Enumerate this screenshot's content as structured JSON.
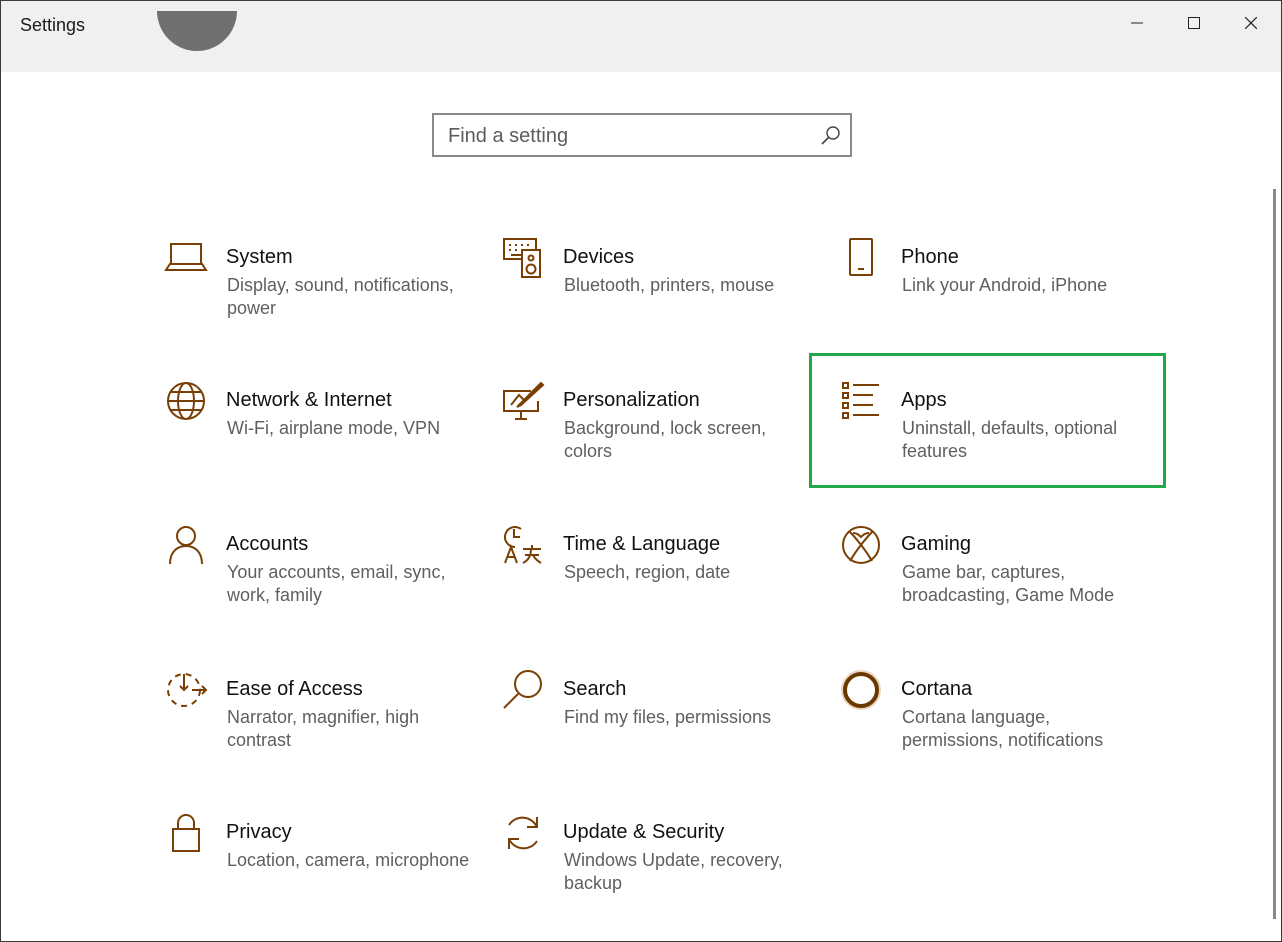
{
  "window": {
    "title": "Settings"
  },
  "search": {
    "placeholder": "Find a setting"
  },
  "colors": {
    "accent": "#7a3f04",
    "highlight": "#22a84a"
  },
  "tiles": [
    {
      "name": "System",
      "desc": "Display, sound, notifications, power",
      "icon": "laptop-icon"
    },
    {
      "name": "Devices",
      "desc": "Bluetooth, printers, mouse",
      "icon": "keyboard-speaker-icon"
    },
    {
      "name": "Phone",
      "desc": "Link your Android, iPhone",
      "icon": "phone-icon"
    },
    {
      "name": "Network & Internet",
      "desc": "Wi-Fi, airplane mode, VPN",
      "icon": "globe-icon"
    },
    {
      "name": "Personalization",
      "desc": "Background, lock screen, colors",
      "icon": "paint-tablet-icon"
    },
    {
      "name": "Apps",
      "desc": "Uninstall, defaults, optional features",
      "icon": "app-list-icon"
    },
    {
      "name": "Accounts",
      "desc": "Your accounts, email, sync, work, family",
      "icon": "person-icon"
    },
    {
      "name": "Time & Language",
      "desc": "Speech, region, date",
      "icon": "time-language-icon"
    },
    {
      "name": "Gaming",
      "desc": "Game bar, captures, broadcasting, Game Mode",
      "icon": "xbox-icon"
    },
    {
      "name": "Ease of Access",
      "desc": "Narrator, magnifier, high contrast",
      "icon": "ease-of-access-icon"
    },
    {
      "name": "Search",
      "desc": "Find my files, permissions",
      "icon": "magnifier-icon"
    },
    {
      "name": "Cortana",
      "desc": "Cortana language, permissions, notifications",
      "icon": "cortana-circle-icon"
    },
    {
      "name": "Privacy",
      "desc": "Location, camera, microphone",
      "icon": "lock-icon"
    },
    {
      "name": "Update & Security",
      "desc": "Windows Update, recovery, backup",
      "icon": "sync-arrows-icon"
    }
  ]
}
